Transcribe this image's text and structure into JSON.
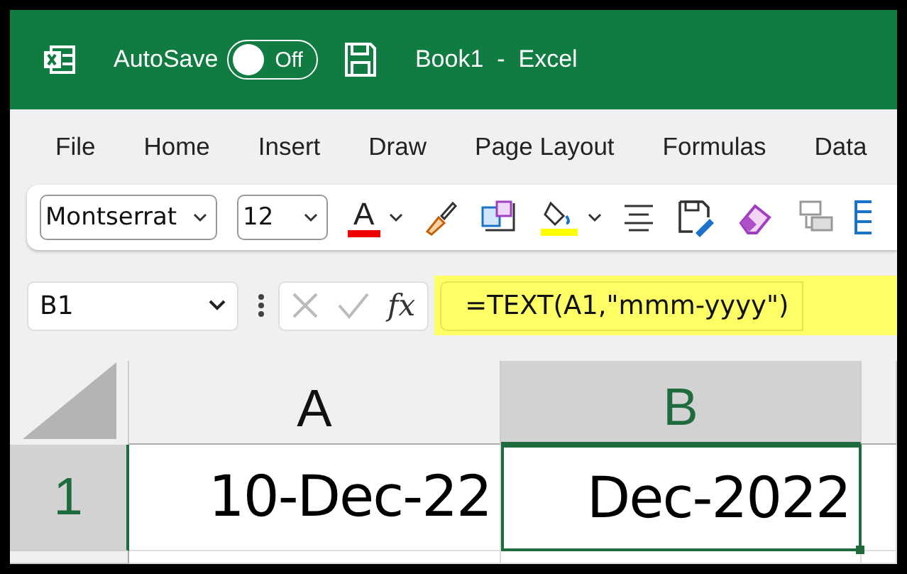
{
  "window": {
    "title": "Book1  -  Excel"
  },
  "autosave": {
    "label": "AutoSave",
    "state_text": "Off",
    "on": false
  },
  "ribbon_tabs": [
    {
      "label": "File"
    },
    {
      "label": "Home"
    },
    {
      "label": "Insert"
    },
    {
      "label": "Draw"
    },
    {
      "label": "Page Layout"
    },
    {
      "label": "Formulas"
    },
    {
      "label": "Data"
    }
  ],
  "toolbar": {
    "font_name": "Montserrat",
    "font_size": "12",
    "font_color_glyph": "A"
  },
  "formula_bar": {
    "name_box": "B1",
    "function_label": "fx",
    "formula": "=TEXT(A1,\"mmm-yyyy\")",
    "highlighted": true
  },
  "grid": {
    "columns": [
      {
        "label": "A",
        "selected": false
      },
      {
        "label": "B",
        "selected": true
      }
    ],
    "rows": [
      {
        "header": "1",
        "selected": true,
        "cells": [
          {
            "value": "10-Dec-22",
            "selected": false
          },
          {
            "value": "Dec-2022",
            "selected": true
          }
        ]
      }
    ]
  }
}
